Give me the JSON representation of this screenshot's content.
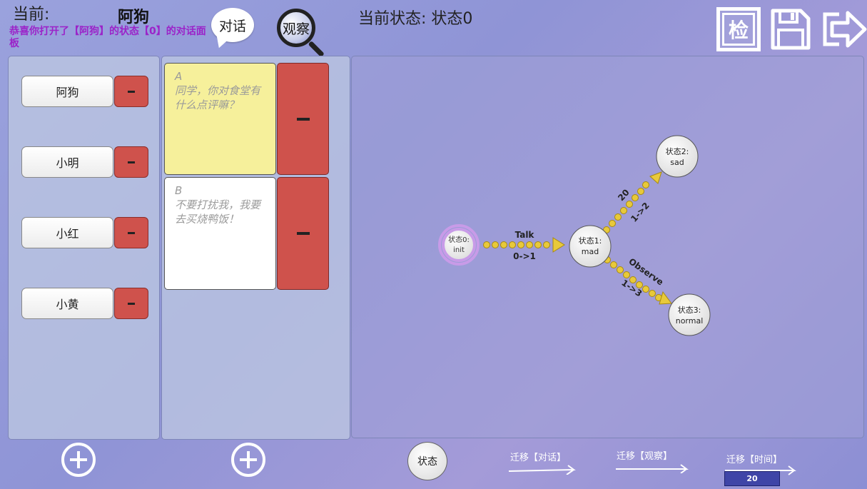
{
  "header": {
    "current_label": "当前:",
    "current_name": "阿狗",
    "notice": "恭喜你打开了【阿狗】的状态【0】的对话面板",
    "talk_label": "对话",
    "observe_label": "观察",
    "state_title": "当前状态: 状态0",
    "check_label": "检"
  },
  "characters": [
    {
      "name": "阿狗"
    },
    {
      "name": "小明"
    },
    {
      "name": "小红"
    },
    {
      "name": "小黄"
    }
  ],
  "dialogs": [
    {
      "letter": "A",
      "text": "同学，你对食堂有什么点评嘛？",
      "bg": "#f6f09b"
    },
    {
      "letter": "B",
      "text": "不要打扰我，我要去买烧鸭饭！",
      "bg": "#ffffff"
    }
  ],
  "graph": {
    "nodes": [
      {
        "id": "n0",
        "label": "状态0:",
        "sub": "init"
      },
      {
        "id": "n1",
        "label": "状态1:",
        "sub": "mad"
      },
      {
        "id": "n2",
        "label": "状态2:",
        "sub": "sad"
      },
      {
        "id": "n3",
        "label": "状态3:",
        "sub": "normal"
      }
    ],
    "edges": [
      {
        "id": "e01",
        "top": "Talk",
        "bottom": "0->1"
      },
      {
        "id": "e12",
        "top": "20",
        "bottom": "1->2"
      },
      {
        "id": "e13",
        "top": "Observe",
        "bottom": "1->3"
      }
    ]
  },
  "footer": {
    "state_label": "状态",
    "trans_talk": "迁移【对话】",
    "trans_observe": "迁移【观察】",
    "trans_time": "迁移【时间】",
    "time_value": "20"
  },
  "colors": {
    "delete": "#cf524c",
    "edge": "#e8c93a",
    "init_ring": "#c89be8"
  }
}
